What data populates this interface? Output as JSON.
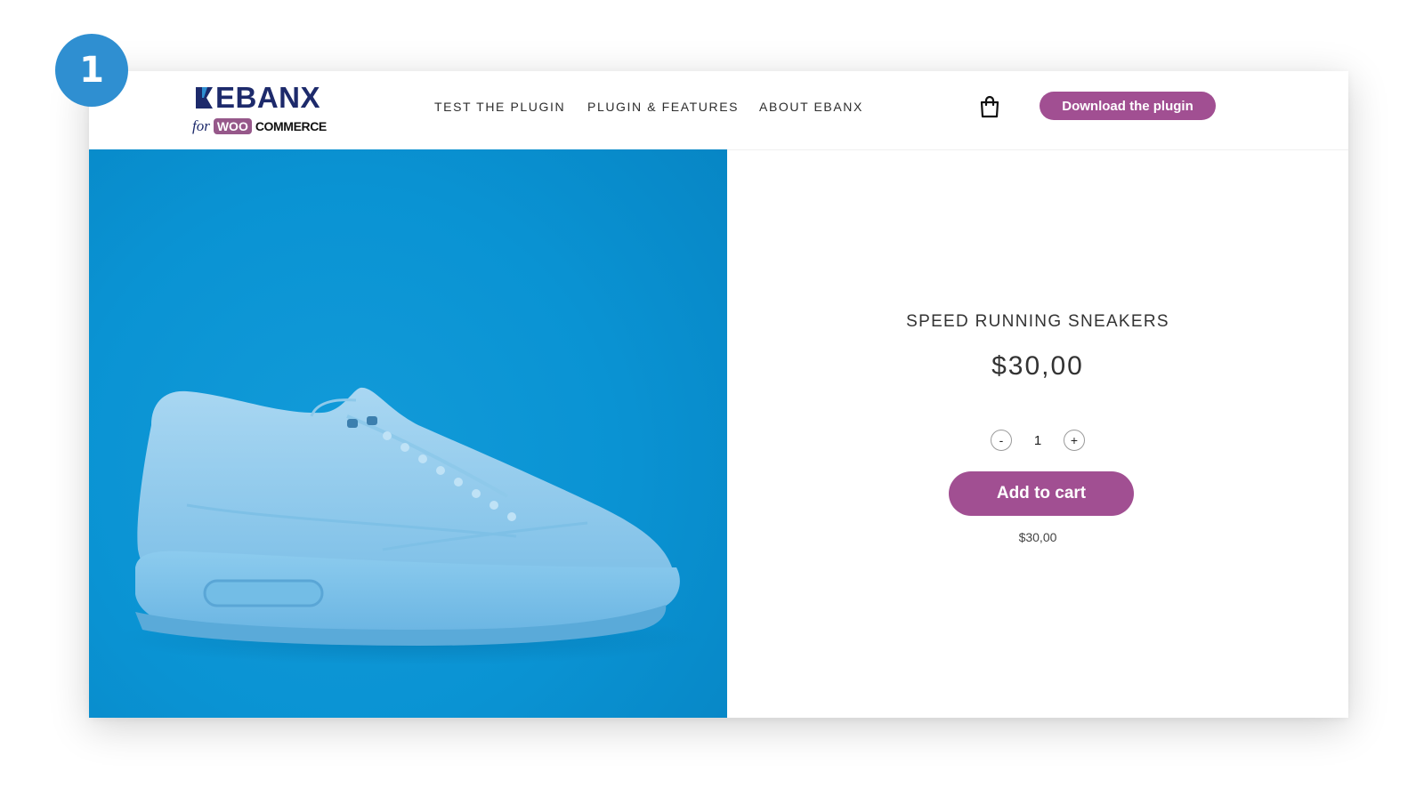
{
  "step": {
    "number": "1"
  },
  "header": {
    "logo": {
      "brand": "EBANX",
      "for": "for",
      "woo": "WOO",
      "commerce": "COMMERCE"
    },
    "nav": [
      {
        "label": "TEST THE PLUGIN"
      },
      {
        "label": "PLUGIN & FEATURES"
      },
      {
        "label": "ABOUT EBANX"
      }
    ],
    "cart_icon": "shopping-bag-icon",
    "download_label": "Download the plugin"
  },
  "product": {
    "image": "blue-sneaker-photo",
    "title": "SPEED RUNNING SNEAKERS",
    "price": "$30,00",
    "quantity": "1",
    "decrement_label": "-",
    "increment_label": "+",
    "add_to_cart_label": "Add to cart",
    "subtotal": "$30,00"
  },
  "colors": {
    "accent": "#a14f92",
    "badge": "#2f8fd1",
    "image_background": "#0a93d3",
    "logo_navy": "#1d2a6b"
  }
}
